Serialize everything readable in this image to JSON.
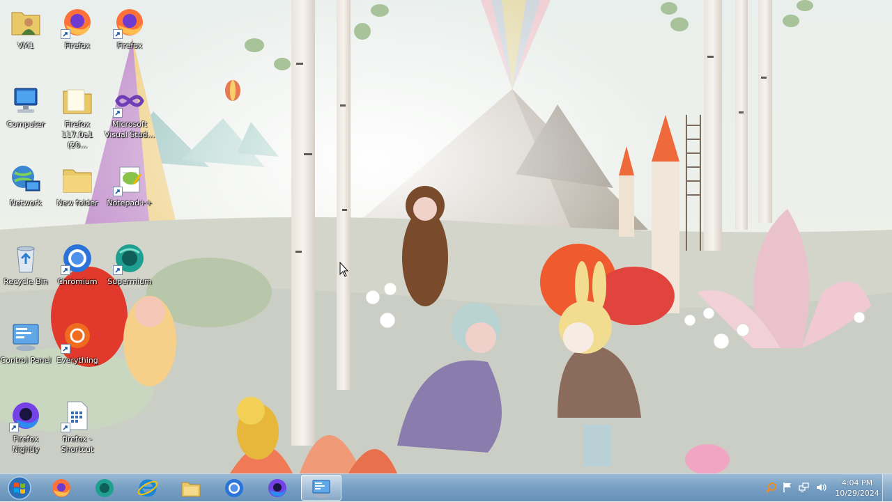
{
  "desktop": {
    "icons": [
      {
        "label": "VM1",
        "icon": "user-folder-icon"
      },
      {
        "label": "Firefox",
        "icon": "firefox-icon"
      },
      {
        "label": "Firefox",
        "icon": "firefox-icon"
      },
      {
        "label": "Computer",
        "icon": "computer-icon"
      },
      {
        "label": "Firefox 117.0a1 (20...",
        "icon": "folder-icon"
      },
      {
        "label": "Microsoft Visual Stud...",
        "icon": "visual-studio-icon"
      },
      {
        "label": "Network",
        "icon": "network-icon"
      },
      {
        "label": "New folder",
        "icon": "folder-icon"
      },
      {
        "label": "Notepad++",
        "icon": "notepad-plus-plus-icon"
      },
      {
        "label": "Recycle Bin",
        "icon": "recycle-bin-icon"
      },
      {
        "label": "Chromium",
        "icon": "chromium-icon"
      },
      {
        "label": "Supermium",
        "icon": "supermium-icon"
      },
      {
        "label": "Control Panel",
        "icon": "control-panel-icon"
      },
      {
        "label": "Everything",
        "icon": "everything-search-icon"
      },
      {
        "label": "Firefox Nightly",
        "icon": "firefox-nightly-icon"
      },
      {
        "label": "firefox - Shortcut",
        "icon": "shortcut-file-icon"
      }
    ]
  },
  "taskbar": {
    "start_icon": "windows-start-orb-icon",
    "pinned": [
      {
        "name": "Firefox",
        "icon": "firefox-icon"
      },
      {
        "name": "Supermium",
        "icon": "supermium-icon"
      },
      {
        "name": "Internet Explorer",
        "icon": "internet-explorer-icon"
      },
      {
        "name": "Windows Explorer",
        "icon": "file-explorer-icon"
      },
      {
        "name": "Chromium",
        "icon": "chromium-icon"
      },
      {
        "name": "Firefox Nightly",
        "icon": "firefox-nightly-icon"
      },
      {
        "name": "Control Panel",
        "icon": "control-panel-icon",
        "active": true
      }
    ],
    "tray": [
      "search-icon",
      "action-center-flag-icon",
      "network-tray-icon",
      "volume-icon"
    ],
    "clock": {
      "time": "4:04 PM",
      "date": "10/29/2024"
    }
  },
  "colors": {
    "taskbar": "#7aa2c6",
    "wallpaper_sky": "#e8ede8",
    "firefox_orange": "#ff7139",
    "firefox_purple": "#7542e5",
    "folder_yellow": "#e9c868"
  }
}
